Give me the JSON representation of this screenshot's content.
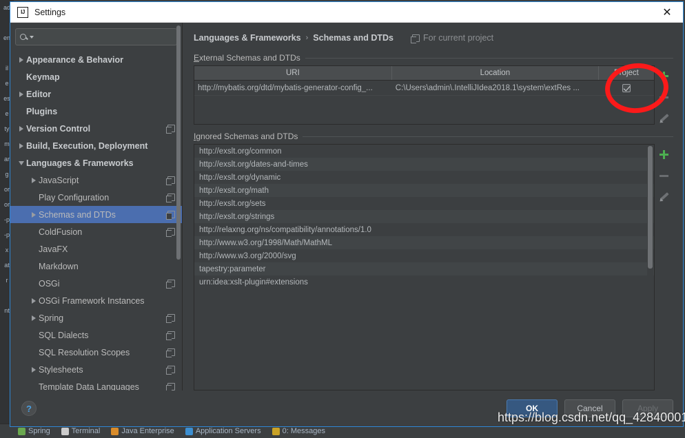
{
  "window": {
    "title": "Settings",
    "logo_icon": "intellij-idea-logo-icon",
    "close_icon": "close-icon"
  },
  "search": {
    "value": "",
    "placeholder": "",
    "icon": "search-icon",
    "dropdown_icon": "chevron-down-icon"
  },
  "sidebar": {
    "items": [
      {
        "label": "Appearance & Behavior",
        "arrow": "right",
        "bold": true,
        "indent": 0,
        "project_icon": false,
        "selected": false
      },
      {
        "label": "Keymap",
        "arrow": "none",
        "bold": true,
        "indent": 0,
        "project_icon": false,
        "selected": false
      },
      {
        "label": "Editor",
        "arrow": "right",
        "bold": true,
        "indent": 0,
        "project_icon": false,
        "selected": false
      },
      {
        "label": "Plugins",
        "arrow": "none",
        "bold": true,
        "indent": 0,
        "project_icon": false,
        "selected": false
      },
      {
        "label": "Version Control",
        "arrow": "right",
        "bold": true,
        "indent": 0,
        "project_icon": true,
        "selected": false
      },
      {
        "label": "Build, Execution, Deployment",
        "arrow": "right",
        "bold": true,
        "indent": 0,
        "project_icon": false,
        "selected": false
      },
      {
        "label": "Languages & Frameworks",
        "arrow": "down",
        "bold": true,
        "indent": 0,
        "project_icon": false,
        "selected": false
      },
      {
        "label": "JavaScript",
        "arrow": "right",
        "bold": false,
        "indent": 1,
        "project_icon": true,
        "selected": false
      },
      {
        "label": "Play Configuration",
        "arrow": "none",
        "bold": false,
        "indent": 1,
        "project_icon": true,
        "selected": false
      },
      {
        "label": "Schemas and DTDs",
        "arrow": "right",
        "bold": false,
        "indent": 1,
        "project_icon": true,
        "selected": true
      },
      {
        "label": "ColdFusion",
        "arrow": "none",
        "bold": false,
        "indent": 1,
        "project_icon": true,
        "selected": false
      },
      {
        "label": "JavaFX",
        "arrow": "none",
        "bold": false,
        "indent": 1,
        "project_icon": false,
        "selected": false
      },
      {
        "label": "Markdown",
        "arrow": "none",
        "bold": false,
        "indent": 1,
        "project_icon": false,
        "selected": false
      },
      {
        "label": "OSGi",
        "arrow": "none",
        "bold": false,
        "indent": 1,
        "project_icon": true,
        "selected": false
      },
      {
        "label": "OSGi Framework Instances",
        "arrow": "right",
        "bold": false,
        "indent": 1,
        "project_icon": false,
        "selected": false
      },
      {
        "label": "Spring",
        "arrow": "right",
        "bold": false,
        "indent": 1,
        "project_icon": true,
        "selected": false
      },
      {
        "label": "SQL Dialects",
        "arrow": "none",
        "bold": false,
        "indent": 1,
        "project_icon": true,
        "selected": false
      },
      {
        "label": "SQL Resolution Scopes",
        "arrow": "none",
        "bold": false,
        "indent": 1,
        "project_icon": true,
        "selected": false
      },
      {
        "label": "Stylesheets",
        "arrow": "right",
        "bold": false,
        "indent": 1,
        "project_icon": true,
        "selected": false
      },
      {
        "label": "Template Data Languages",
        "arrow": "none",
        "bold": false,
        "indent": 1,
        "project_icon": true,
        "selected": false
      }
    ]
  },
  "breadcrumb": {
    "parent": "Languages & Frameworks",
    "separator": "›",
    "current": "Schemas and DTDs",
    "scope_label": "For current project",
    "scope_icon": "project-scope-icon"
  },
  "external": {
    "section_title": "External Schemas and DTDs",
    "columns": [
      "URI",
      "Location",
      "Project"
    ],
    "rows": [
      {
        "uri": "http://mybatis.org/dtd/mybatis-generator-config_...",
        "location": "C:\\Users\\admin\\.IntelliJIdea2018.1\\system\\extRes ...",
        "project_checked": true
      }
    ],
    "tools": [
      {
        "name": "add-button",
        "icon": "plus-icon",
        "enabled": true
      },
      {
        "name": "remove-button",
        "icon": "minus-icon",
        "enabled": false
      },
      {
        "name": "edit-button",
        "icon": "pencil-icon",
        "enabled": true
      }
    ]
  },
  "ignored": {
    "section_title": "Ignored Schemas and DTDs",
    "rows": [
      "http://exslt.org/common",
      "http://exslt.org/dates-and-times",
      "http://exslt.org/dynamic",
      "http://exslt.org/math",
      "http://exslt.org/sets",
      "http://exslt.org/strings",
      "http://relaxng.org/ns/compatibility/annotations/1.0",
      "http://www.w3.org/1998/Math/MathML",
      "http://www.w3.org/2000/svg",
      "tapestry:parameter",
      "urn:idea:xslt-plugin#extensions"
    ],
    "tools": [
      {
        "name": "add-button",
        "icon": "plus-icon",
        "enabled": true
      },
      {
        "name": "remove-button",
        "icon": "minus-icon",
        "enabled": false
      },
      {
        "name": "edit-button",
        "icon": "pencil-icon",
        "enabled": true
      }
    ]
  },
  "footer": {
    "help_label": "?",
    "ok_label": "OK",
    "cancel_label": "Cancel",
    "apply_label": "Apply"
  },
  "overlays": {
    "watermark": "https://blog.csdn.net/qq_42840001",
    "annotation_color": "#fb1a1a",
    "annotation_name": "red-circle-annotation"
  },
  "background_ide": {
    "tool_windows": [
      {
        "label": "Spring",
        "color": "#6aa84f"
      },
      {
        "label": "Terminal",
        "color": "#cccccc"
      },
      {
        "label": "Java Enterprise",
        "color": "#d98c2b"
      },
      {
        "label": "Application Servers",
        "color": "#3d8fd1"
      },
      {
        "label": "0: Messages",
        "color": "#c9a227"
      }
    ],
    "left_fragments": [
      "ad",
      "",
      "en",
      "",
      "il",
      "e",
      "es",
      "e",
      "ty",
      "m",
      "ar",
      "g",
      "or",
      "or",
      "-p",
      "-p",
      "x",
      "at",
      "r",
      "",
      "nt"
    ]
  },
  "colors": {
    "accent_blue": "#4b6eaf",
    "dialog_bg": "#3c3f41",
    "title_bg": "#ffffff",
    "ok_button": "#365880",
    "plus_green": "#4caf50"
  }
}
